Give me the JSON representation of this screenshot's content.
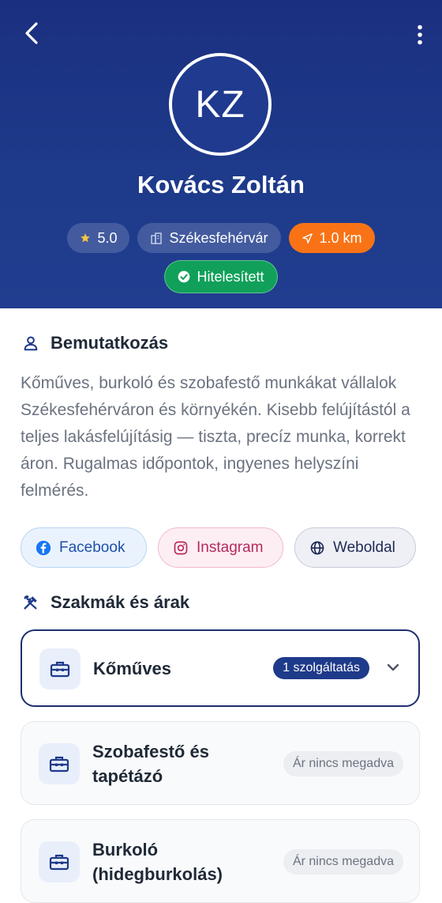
{
  "header": {
    "back_icon": "chevron-left-icon",
    "more_icon": "more-vertical-icon",
    "avatar_initials": "KZ",
    "name": "Kovács Zoltán",
    "rating": "5.0",
    "city": "Székesfehérvár",
    "distance": "1.0 km",
    "verified_label": "Hitelesített",
    "colors": {
      "background": "#1e3a8a",
      "distance_chip": "#f97316",
      "verified_chip": "#10a05a",
      "star": "#f5c542"
    }
  },
  "intro": {
    "title": "Bemutatkozás",
    "icon": "user-icon",
    "text": "Kőműves, burkoló és szobafestő munkákat vállalok Székesfehérváron és környékén. Kisebb felújítástól a teljes lakásfelújításig — tiszta, precíz munka, korrekt áron. Rugalmas időpontok, ingyenes helyszíni felmérés."
  },
  "social": {
    "facebook": "Facebook",
    "instagram": "Instagram",
    "website": "Weboldal"
  },
  "trades": {
    "title": "Szakmák és árak",
    "icon": "tools-icon",
    "items": [
      {
        "name": "Kőműves",
        "badge": "1 szolgáltatás",
        "expanded_control": "chevron-down-icon"
      },
      {
        "name_line1": "Szobafestő és",
        "name_line2": "tapétázó",
        "price": "Ár nincs megadva"
      },
      {
        "name_line1": "Burkoló",
        "name_line2": "(hidegburkolás)",
        "price": "Ár nincs megadva"
      }
    ]
  }
}
